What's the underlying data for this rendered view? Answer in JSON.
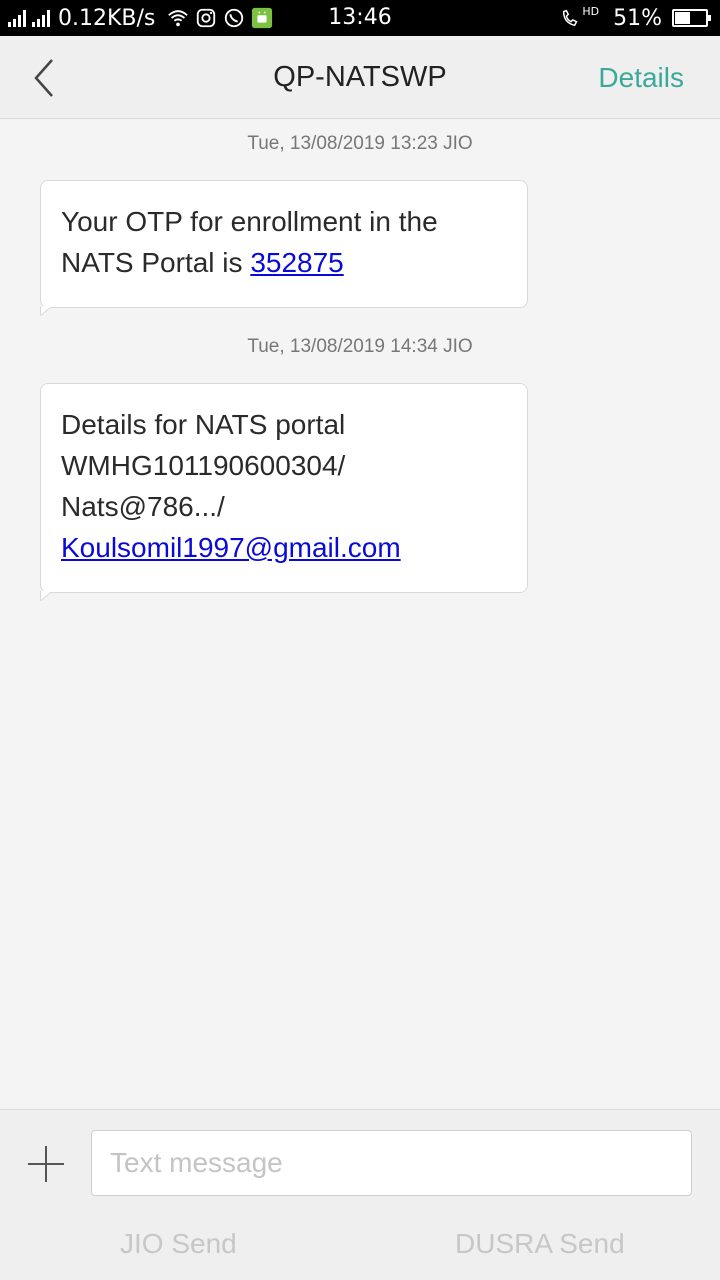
{
  "status_bar": {
    "speed": "0.12KB/s",
    "time": "13:46",
    "hd_label": "HD",
    "battery": "51%",
    "battery_level": 0.51
  },
  "header": {
    "title": "QP-NATSWP",
    "details_label": "Details"
  },
  "messages": [
    {
      "timestamp": "Tue, 13/08/2019  13:23  JIO",
      "text_before": "Your OTP for enrollment in the NATS Portal is ",
      "link": "352875"
    },
    {
      "timestamp": "Tue, 13/08/2019  14:34  JIO",
      "line1": "Details for NATS portal",
      "line2": "WMHG101190600304/",
      "line3": "Nats@786.../",
      "link": "Koulsomil1997@gmail.com"
    }
  ],
  "composer": {
    "placeholder": "Text message",
    "send_jio": "JIO Send",
    "send_dusra": "DUSRA Send"
  },
  "colors": {
    "accent": "#3aa99a",
    "link": "#0a0ad8"
  }
}
